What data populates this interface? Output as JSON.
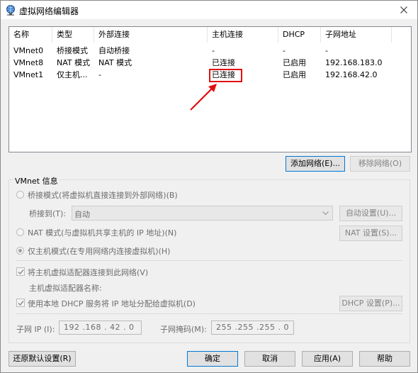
{
  "window": {
    "title": "虚拟网络编辑器",
    "icon": "network-globe-icon",
    "close_icon": "close-icon"
  },
  "table": {
    "headers": [
      "名称",
      "类型",
      "外部连接",
      "主机连接",
      "DHCP",
      "子网地址"
    ],
    "rows": [
      [
        "VMnet0",
        "桥接模式",
        "自动桥接",
        "-",
        "-",
        "-"
      ],
      [
        "VMnet8",
        "NAT 模式",
        "NAT 模式",
        "已连接",
        "已启用",
        "192.168.183.0"
      ],
      [
        "VMnet1",
        "仅主机...",
        "-",
        "已连接",
        "已启用",
        "192.168.42.0"
      ]
    ]
  },
  "buttons": {
    "add_network": "添加网络(E)...",
    "remove_network": "移除网络(O)",
    "auto_settings": "自动设置(U)...",
    "nat_settings": "NAT 设置(S)...",
    "dhcp_settings": "DHCP 设置(P)...",
    "restore_defaults": "还原默认设置(R)",
    "ok": "确定",
    "cancel": "取消",
    "apply": "应用(A)",
    "help": "帮助"
  },
  "vmnet_info": {
    "group_title": "VMnet 信息",
    "bridged_label": "桥接模式(将虚拟机直接连接到外部网络)(B)",
    "bridged_to_label": "桥接到(T):",
    "bridged_to_value": "自动",
    "nat_label": "NAT 模式(与虚拟机共享主机的 IP 地址)(N)",
    "hostonly_label": "仅主机模式(在专用网络内连接虚拟机)(H)",
    "connect_adapter_label": "将主机虚拟适配器连接到此网络(V)",
    "adapter_name_label": "主机虚拟适配器名称:",
    "use_dhcp_label": "使用本地 DHCP 服务将 IP 地址分配给虚拟机(D)",
    "subnet_ip_label": "子网 IP (I):",
    "subnet_ip_value": "192 .168 . 42 . 0",
    "subnet_mask_label": "子网掩码(M):",
    "subnet_mask_value": "255 .255 .255 . 0"
  },
  "colors": {
    "annotation": "#e01010",
    "focus_border": "#0078d7"
  }
}
